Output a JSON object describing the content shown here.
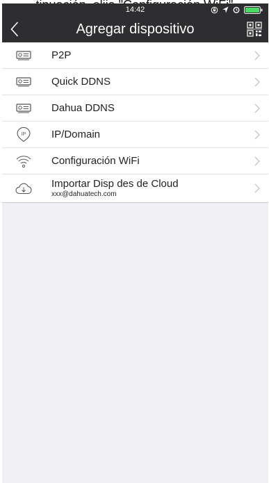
{
  "caption": "tinuación, elija \"Configuración WiFi\"",
  "status_bar": {
    "time": "14:42"
  },
  "header": {
    "title": "Agregar dispositivo"
  },
  "items": [
    {
      "label": "P2P",
      "icon": "device-icon"
    },
    {
      "label": "Quick DDNS",
      "icon": "device-icon"
    },
    {
      "label": "Dahua DDNS",
      "icon": "device-icon"
    },
    {
      "label": "IP/Domain",
      "icon": "ip-icon"
    },
    {
      "label": "Configuración WiFi",
      "icon": "wifi-icon"
    },
    {
      "label": "Importar Disp des de Cloud",
      "sublabel": "xxx@dahuatech.com",
      "icon": "cloud-download-icon"
    }
  ],
  "colors": {
    "header_bg": "#2e2e30",
    "page_bg": "#efeff4",
    "list_bg": "#ffffff",
    "battery": "#4cd964"
  }
}
